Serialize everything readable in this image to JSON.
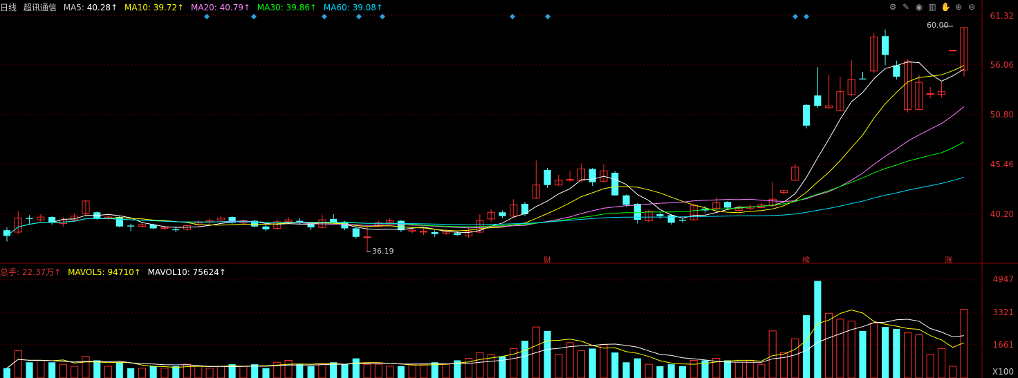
{
  "header": {
    "period": "日线",
    "name": "超讯通信",
    "ma5": {
      "label": "MA5:",
      "value": "40.28↑",
      "color": "#ffffff"
    },
    "ma10": {
      "label": "MA10:",
      "value": "39.72↑",
      "color": "#ffff00"
    },
    "ma20": {
      "label": "MA20:",
      "value": "40.79↑",
      "color": "#ff80ff"
    },
    "ma30": {
      "label": "MA30:",
      "value": "39.86↑",
      "color": "#00ff00"
    },
    "ma60": {
      "label": "MA60:",
      "value": "39.08↑",
      "color": "#00e0ff"
    }
  },
  "vol_header": {
    "total": "总手: 22.37万↑",
    "mavol5": "MAVOL5: 94710↑",
    "mavol10": "MAVOL10: 75624↑"
  },
  "tools": [
    "gear-icon",
    "pen-icon",
    "eye-icon",
    "trash-icon",
    "hand-icon",
    "plus-circle-icon",
    "minus-circle-icon"
  ],
  "price_axis": [
    "61.32",
    "56.06",
    "50.80",
    "45.46",
    "40.20"
  ],
  "vol_axis": [
    "4947",
    "3321",
    "1661"
  ],
  "vol_unit": "X100",
  "annotations": {
    "high": "60.00",
    "low": "36.19",
    "markers": [
      "财",
      "榜",
      "涨"
    ]
  },
  "chart_data": {
    "type": "candlestick",
    "price_range": [
      35.5,
      61.32
    ],
    "volume_range": [
      0,
      5000
    ],
    "candles": [
      [
        38.5,
        37.9,
        38.8,
        37.3,
        500
      ],
      [
        38.3,
        39.8,
        40.5,
        38.1,
        1400
      ],
      [
        39.8,
        39.7,
        40.1,
        39.2,
        800
      ],
      [
        39.6,
        39.9,
        40.2,
        39.4,
        900
      ],
      [
        39.9,
        39.3,
        40.0,
        39.1,
        800
      ],
      [
        39.2,
        39.6,
        39.9,
        38.9,
        700
      ],
      [
        39.6,
        40.0,
        40.3,
        39.4,
        600
      ],
      [
        40.3,
        41.6,
        41.7,
        40.1,
        1100
      ],
      [
        40.4,
        39.8,
        40.5,
        39.6,
        900
      ],
      [
        39.8,
        39.9,
        40.1,
        39.6,
        600
      ],
      [
        39.9,
        38.9,
        40.0,
        38.8,
        800
      ],
      [
        39.0,
        38.9,
        39.2,
        38.4,
        500
      ],
      [
        38.9,
        39.1,
        39.3,
        38.8,
        500
      ],
      [
        39.1,
        38.7,
        39.2,
        38.6,
        600
      ],
      [
        38.7,
        38.8,
        38.9,
        38.5,
        500
      ],
      [
        38.6,
        38.5,
        38.9,
        38.3,
        600
      ],
      [
        38.6,
        39.0,
        39.1,
        38.4,
        700
      ],
      [
        39.1,
        39.3,
        39.6,
        38.9,
        600
      ],
      [
        39.4,
        39.5,
        39.8,
        39.1,
        500
      ],
      [
        39.6,
        39.8,
        40.0,
        39.5,
        600
      ],
      [
        39.9,
        39.3,
        40.0,
        39.2,
        700
      ],
      [
        39.3,
        39.5,
        39.6,
        39.1,
        600
      ],
      [
        39.5,
        38.9,
        39.6,
        38.8,
        700
      ],
      [
        38.9,
        38.6,
        39.1,
        38.4,
        500
      ],
      [
        38.7,
        39.4,
        39.7,
        38.5,
        800
      ],
      [
        39.4,
        39.6,
        39.9,
        39.2,
        900
      ],
      [
        39.5,
        39.3,
        39.8,
        39.1,
        700
      ],
      [
        39.3,
        38.8,
        39.4,
        38.5,
        600
      ],
      [
        38.8,
        39.6,
        40.1,
        38.7,
        700
      ],
      [
        39.7,
        39.3,
        40.2,
        39.2,
        800
      ],
      [
        39.4,
        38.7,
        39.5,
        38.5,
        700
      ],
      [
        38.7,
        37.8,
        38.9,
        37.6,
        1000
      ],
      [
        37.8,
        37.8,
        38.9,
        36.2,
        700
      ],
      [
        38.9,
        39.3,
        39.5,
        38.8,
        700
      ],
      [
        39.3,
        39.5,
        39.8,
        39.2,
        600
      ],
      [
        39.5,
        38.5,
        39.6,
        38.3,
        600
      ],
      [
        38.4,
        38.5,
        38.7,
        38.2,
        700
      ],
      [
        38.3,
        38.4,
        38.8,
        38.0,
        700
      ],
      [
        38.3,
        38.1,
        38.5,
        37.8,
        800
      ],
      [
        38.2,
        38.4,
        38.6,
        38.0,
        700
      ],
      [
        38.2,
        38.0,
        38.4,
        37.9,
        900
      ],
      [
        37.9,
        38.4,
        38.8,
        37.7,
        1000
      ],
      [
        38.3,
        39.5,
        40.2,
        38.2,
        1300
      ],
      [
        39.7,
        40.4,
        40.7,
        39.4,
        1200
      ],
      [
        40.4,
        40.0,
        40.6,
        39.8,
        1100
      ],
      [
        40.0,
        41.2,
        41.8,
        39.9,
        1500
      ],
      [
        41.3,
        40.2,
        41.5,
        40.0,
        1900
      ],
      [
        41.9,
        43.3,
        45.9,
        41.8,
        2600
      ],
      [
        44.9,
        43.3,
        45.1,
        43.0,
        2400
      ],
      [
        43.3,
        43.8,
        44.4,
        43.2,
        1200
      ],
      [
        43.8,
        43.9,
        44.8,
        43.6,
        1800
      ],
      [
        43.8,
        45.0,
        45.6,
        43.6,
        1400
      ],
      [
        45.0,
        43.6,
        45.1,
        43.2,
        1500
      ],
      [
        43.7,
        44.8,
        45.5,
        43.6,
        1700
      ],
      [
        44.6,
        42.2,
        44.8,
        42.2,
        1300
      ],
      [
        42.2,
        41.2,
        42.3,
        41.0,
        800
      ],
      [
        41.3,
        39.6,
        41.4,
        39.2,
        1000
      ],
      [
        39.5,
        40.5,
        40.7,
        39.3,
        700
      ],
      [
        40.2,
        40.0,
        40.4,
        39.7,
        600
      ],
      [
        40.1,
        39.3,
        40.2,
        39.1,
        700
      ],
      [
        39.6,
        39.5,
        39.8,
        39.3,
        600
      ],
      [
        39.6,
        41.1,
        41.3,
        39.5,
        900
      ],
      [
        40.8,
        40.6,
        41.1,
        40.3,
        900
      ],
      [
        40.8,
        41.4,
        42.0,
        40.6,
        1000
      ],
      [
        41.5,
        40.9,
        41.6,
        40.7,
        900
      ],
      [
        40.6,
        40.8,
        41.1,
        40.5,
        800
      ],
      [
        40.8,
        41.0,
        41.3,
        40.6,
        900
      ],
      [
        40.9,
        41.2,
        41.4,
        40.8,
        700
      ],
      [
        41.1,
        41.8,
        43.6,
        41.0,
        2400
      ],
      [
        42.5,
        42.7,
        42.8,
        42.3,
        1300
      ],
      [
        43.8,
        45.2,
        45.5,
        43.8,
        2000
      ],
      [
        51.8,
        49.6,
        51.9,
        49.3,
        3200
      ],
      [
        52.8,
        51.7,
        55.8,
        51.5,
        4947
      ],
      [
        51.5,
        51.7,
        55.0,
        51.4,
        3300
      ],
      [
        51.2,
        53.2,
        54.8,
        51.1,
        3000
      ],
      [
        52.9,
        54.5,
        56.6,
        52.7,
        2900
      ],
      [
        54.6,
        54.5,
        55.3,
        54.5,
        2400
      ],
      [
        55.4,
        59.0,
        59.4,
        55.2,
        2800
      ],
      [
        59.1,
        57.1,
        59.8,
        56.0,
        2600
      ],
      [
        56.0,
        54.8,
        56.5,
        54.5,
        2500
      ],
      [
        51.3,
        56.4,
        56.7,
        51.0,
        2300
      ],
      [
        51.3,
        54.2,
        55.0,
        51.3,
        2200
      ],
      [
        53.0,
        53.0,
        53.7,
        52.5,
        1200
      ],
      [
        52.9,
        53.2,
        54.2,
        52.6,
        1500
      ],
      [
        57.6,
        57.6,
        57.6,
        57.6,
        600
      ],
      [
        55.5,
        60.0,
        60.0,
        54.8,
        3500
      ]
    ],
    "ma": [
      {
        "name": "MA5",
        "color": "#ffffff"
      },
      {
        "name": "MA10",
        "color": "#ffff00"
      },
      {
        "name": "MA20",
        "color": "#ff80ff"
      },
      {
        "name": "MA30",
        "color": "#00ff00"
      },
      {
        "name": "MA60",
        "color": "#00e0ff"
      }
    ],
    "vol_ma": [
      {
        "name": "MAVOL5",
        "color": "#ffff00"
      },
      {
        "name": "MAVOL10",
        "color": "#ffffff"
      }
    ]
  }
}
